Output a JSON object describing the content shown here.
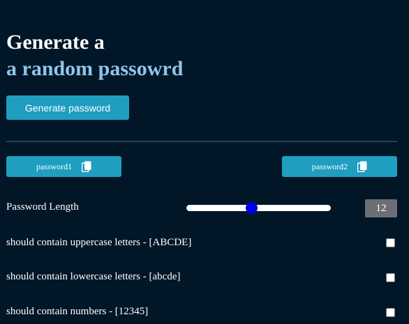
{
  "header": {
    "title_line1": "Generate a",
    "title_line2": "a random passowrd",
    "title_line2_color": "#8fc6e8"
  },
  "actions": {
    "generate_label": "Generate password",
    "accent_color": "#1f9ec0"
  },
  "passwords": [
    {
      "label": "password1",
      "icon": "copy-icon"
    },
    {
      "label": "password2",
      "icon": "copy-icon"
    }
  ],
  "length": {
    "label": "Password Length",
    "value": "12",
    "slider_fraction": 0.45
  },
  "options": [
    {
      "label": "should contain uppercase letters - [ABCDE]",
      "checked": false
    },
    {
      "label": "should contain lowercase letters - [abcde]",
      "checked": false
    },
    {
      "label": "should contain numbers - [12345]",
      "checked": false
    }
  ],
  "theme": {
    "background": "#011627"
  }
}
